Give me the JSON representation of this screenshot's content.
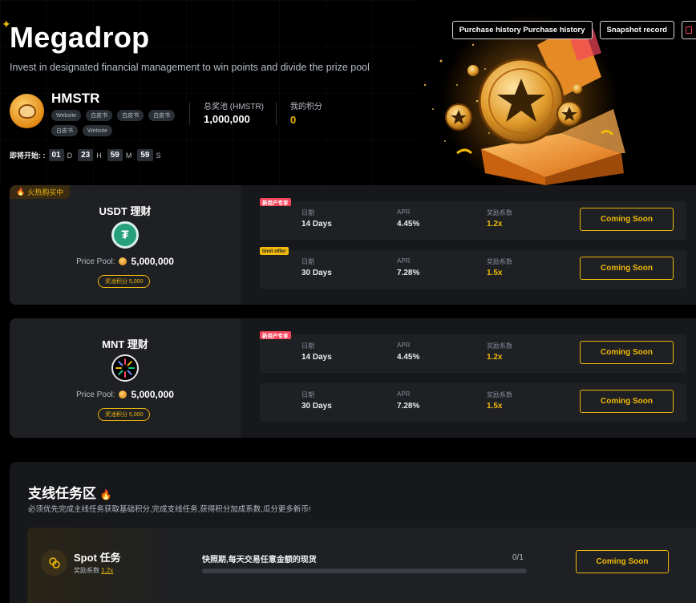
{
  "header": {
    "title": "Megadrop",
    "subtitle": "Invest in designated financial management to win points and divide the prize pool",
    "buttons": [
      "Purchase history Purchase history",
      "Snapshot record"
    ]
  },
  "token": {
    "name": "HMSTR",
    "tags": [
      "Website",
      "白皮书",
      "白皮书",
      "白皮书",
      "白皮书",
      "Website"
    ],
    "prize_pool_label": "总奖池 (HMSTR)",
    "prize_pool_value": "1,000,000",
    "my_points_label": "我的积分",
    "my_points_value": "0"
  },
  "countdown": {
    "label": "即将开始: :",
    "days": "01",
    "days_unit": "D",
    "hours": "23",
    "hours_unit": "H",
    "minutes": "59",
    "minutes_unit": "M",
    "seconds": "59",
    "seconds_unit": "S"
  },
  "pools": [
    {
      "hot_tag": "火热购买中",
      "title": "USDT 理财",
      "coin_icon": "usdt-coin-icon",
      "price_pool_label": "Price Pool:",
      "price_pool_value": "5,000,000",
      "points_pill": "奖池积分 5,000",
      "products": [
        {
          "ribbon": "新用户专享",
          "ribbon_color": "#f6465d",
          "date_label": "日期",
          "date_value": "14 Days",
          "apr_label": "APR",
          "apr_value": "4.45%",
          "mult_label": "奖励系数",
          "mult_value": "1.2x",
          "button": "Coming Soon"
        },
        {
          "ribbon": "limit offer",
          "ribbon_color": "#f0b90b",
          "date_label": "日期",
          "date_value": "30 Days",
          "apr_label": "APR",
          "apr_value": "7.28%",
          "mult_label": "奖励系数",
          "mult_value": "1.5x",
          "button": "Coming Soon"
        }
      ]
    },
    {
      "hot_tag": "",
      "title": "MNT 理财",
      "coin_icon": "mnt-coin-icon",
      "price_pool_label": "Price Pool:",
      "price_pool_value": "5,000,000",
      "points_pill": "奖池积分 5,000",
      "products": [
        {
          "ribbon": "新用户专享",
          "ribbon_color": "#f6465d",
          "date_label": "日期",
          "date_value": "14 Days",
          "apr_label": "APR",
          "apr_value": "4.45%",
          "mult_label": "奖励系数",
          "mult_value": "1.2x",
          "button": "Coming Soon"
        },
        {
          "ribbon": "",
          "ribbon_color": "",
          "date_label": "日期",
          "date_value": "30 Days",
          "apr_label": "APR",
          "apr_value": "7.28%",
          "mult_label": "奖励系数",
          "mult_value": "1.5x",
          "button": "Coming Soon"
        }
      ]
    }
  ],
  "tasks": {
    "title": "支线任务区",
    "subtitle": "必须优先完成主线任务获取基础积分,完成支线任务,获得积分加成系数,瓜分更多新币!",
    "items": [
      {
        "name": "Spot 任务",
        "mult_label": "奖励系数",
        "mult_value": "1.2x",
        "description": "快照期,每天交易任意金额的现货",
        "progress_text": "0/1",
        "progress_fraction": 0,
        "button": "Coming Soon"
      }
    ]
  },
  "colors": {
    "accent": "#f0b90b",
    "danger": "#f6465d",
    "background": "#000000",
    "card": "#16181b"
  }
}
